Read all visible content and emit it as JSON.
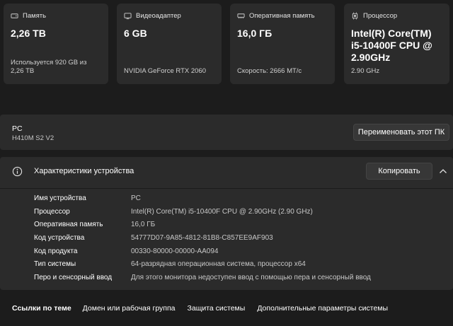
{
  "cards": [
    {
      "icon": "storage-icon",
      "label": "Память",
      "value": "2,26 TB",
      "sub": "Используется 920 GB из 2,26 TB"
    },
    {
      "icon": "gpu-icon",
      "label": "Видеоадаптер",
      "value": "6 GB",
      "sub": "NVIDIA GeForce RTX 2060"
    },
    {
      "icon": "ram-icon",
      "label": "Оперативная память",
      "value": "16,0 ГБ",
      "sub": "Скорость: 2666 МТ/с"
    },
    {
      "icon": "cpu-icon",
      "label": "Процессор",
      "value": "Intel(R) Core(TM) i5-10400F CPU @ 2.90GHz",
      "sub": "2.90 GHz"
    }
  ],
  "pc": {
    "name": "PC",
    "model": "H410M S2 V2",
    "rename_label": "Переименовать этот ПК"
  },
  "specs": {
    "title": "Характеристики устройства",
    "copy_label": "Копировать",
    "rows": [
      {
        "key": "Имя устройства",
        "value": "PC"
      },
      {
        "key": "Процессор",
        "value": "Intel(R) Core(TM) i5-10400F CPU @ 2.90GHz (2.90 GHz)"
      },
      {
        "key": "Оперативная память",
        "value": "16,0 ГБ"
      },
      {
        "key": "Код устройства",
        "value": "54777D07-9A85-4812-81B8-C857EE9AF903"
      },
      {
        "key": "Код продукта",
        "value": "00330-80000-00000-AA094"
      },
      {
        "key": "Тип системы",
        "value": "64-разрядная операционная система, процессор x64"
      },
      {
        "key": "Перо и сенсорный ввод",
        "value": "Для этого монитора недоступен ввод с помощью пера и сенсорный ввод"
      }
    ]
  },
  "related": {
    "title": "Ссылки по теме",
    "links": [
      "Домен или рабочая группа",
      "Защита системы",
      "Дополнительные параметры системы"
    ]
  }
}
